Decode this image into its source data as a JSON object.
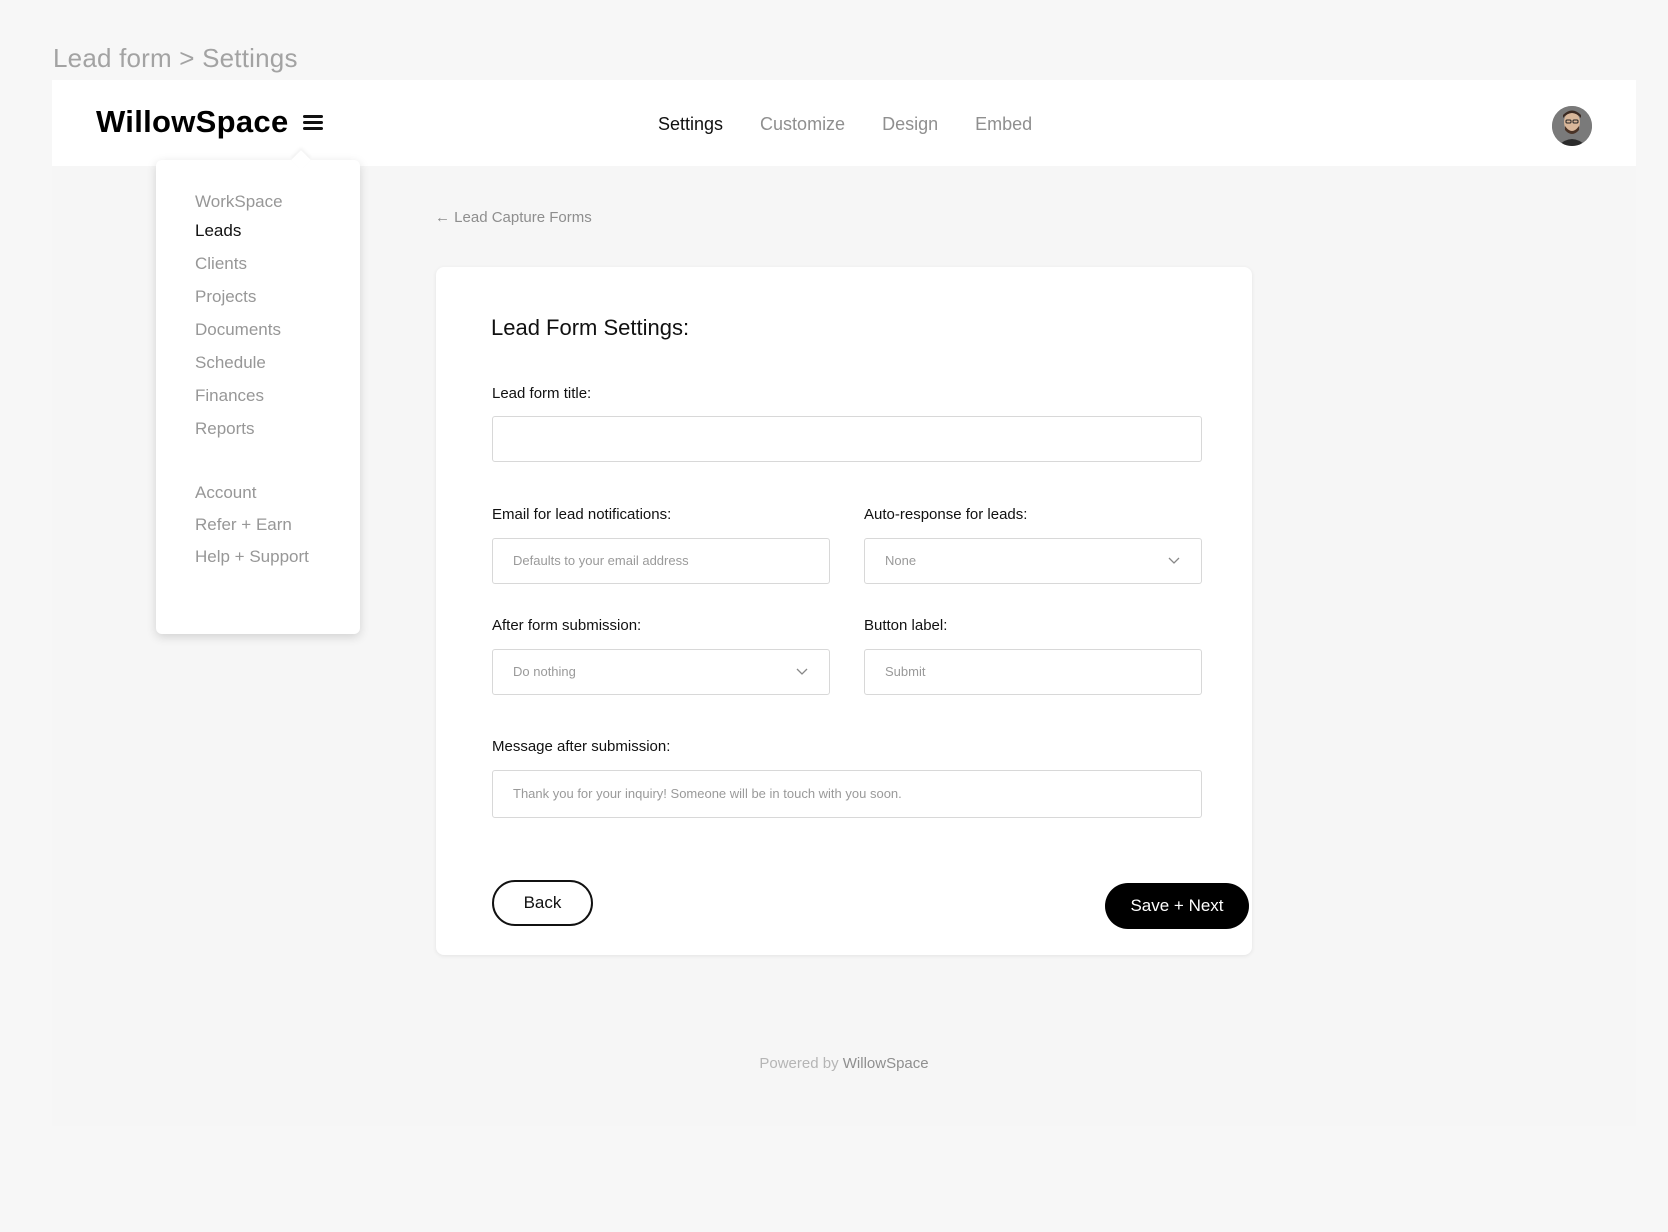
{
  "breadcrumb": "Lead form > Settings",
  "brand": "WillowSpace",
  "nav": {
    "tabs": [
      {
        "label": "Settings",
        "active": true
      },
      {
        "label": "Customize",
        "active": false
      },
      {
        "label": "Design",
        "active": false
      },
      {
        "label": "Embed",
        "active": false
      }
    ]
  },
  "menu": {
    "items": [
      {
        "label": "WorkSpace",
        "active": false
      },
      {
        "label": "Leads",
        "active": true
      },
      {
        "label": "Clients",
        "active": false
      },
      {
        "label": "Projects",
        "active": false
      },
      {
        "label": "Documents",
        "active": false
      },
      {
        "label": "Schedule",
        "active": false
      },
      {
        "label": "Finances",
        "active": false
      },
      {
        "label": "Reports",
        "active": false
      },
      {
        "label": "Account",
        "active": false
      },
      {
        "label": "Refer + Earn",
        "active": false
      },
      {
        "label": "Help + Support",
        "active": false
      }
    ]
  },
  "back_link": "← Lead Capture Forms",
  "form": {
    "title": "Lead Form Settings:",
    "lead_title_label": "Lead form title:",
    "lead_title_value": "",
    "email_label": "Email for lead notifications:",
    "email_placeholder": "Defaults to your email address",
    "auto_label": "Auto-response for leads:",
    "auto_value": "None",
    "after_label": "After form submission:",
    "after_value": "Do nothing",
    "button_label_label": "Button label:",
    "button_label_placeholder": "Submit",
    "message_label": "Message after submission:",
    "message_placeholder": "Thank you for your inquiry! Someone will be in touch with you soon.",
    "back_button": "Back",
    "next_button": "Save + Next"
  },
  "footer": {
    "prefix": "Powered by",
    "brand": "WillowSpace"
  }
}
